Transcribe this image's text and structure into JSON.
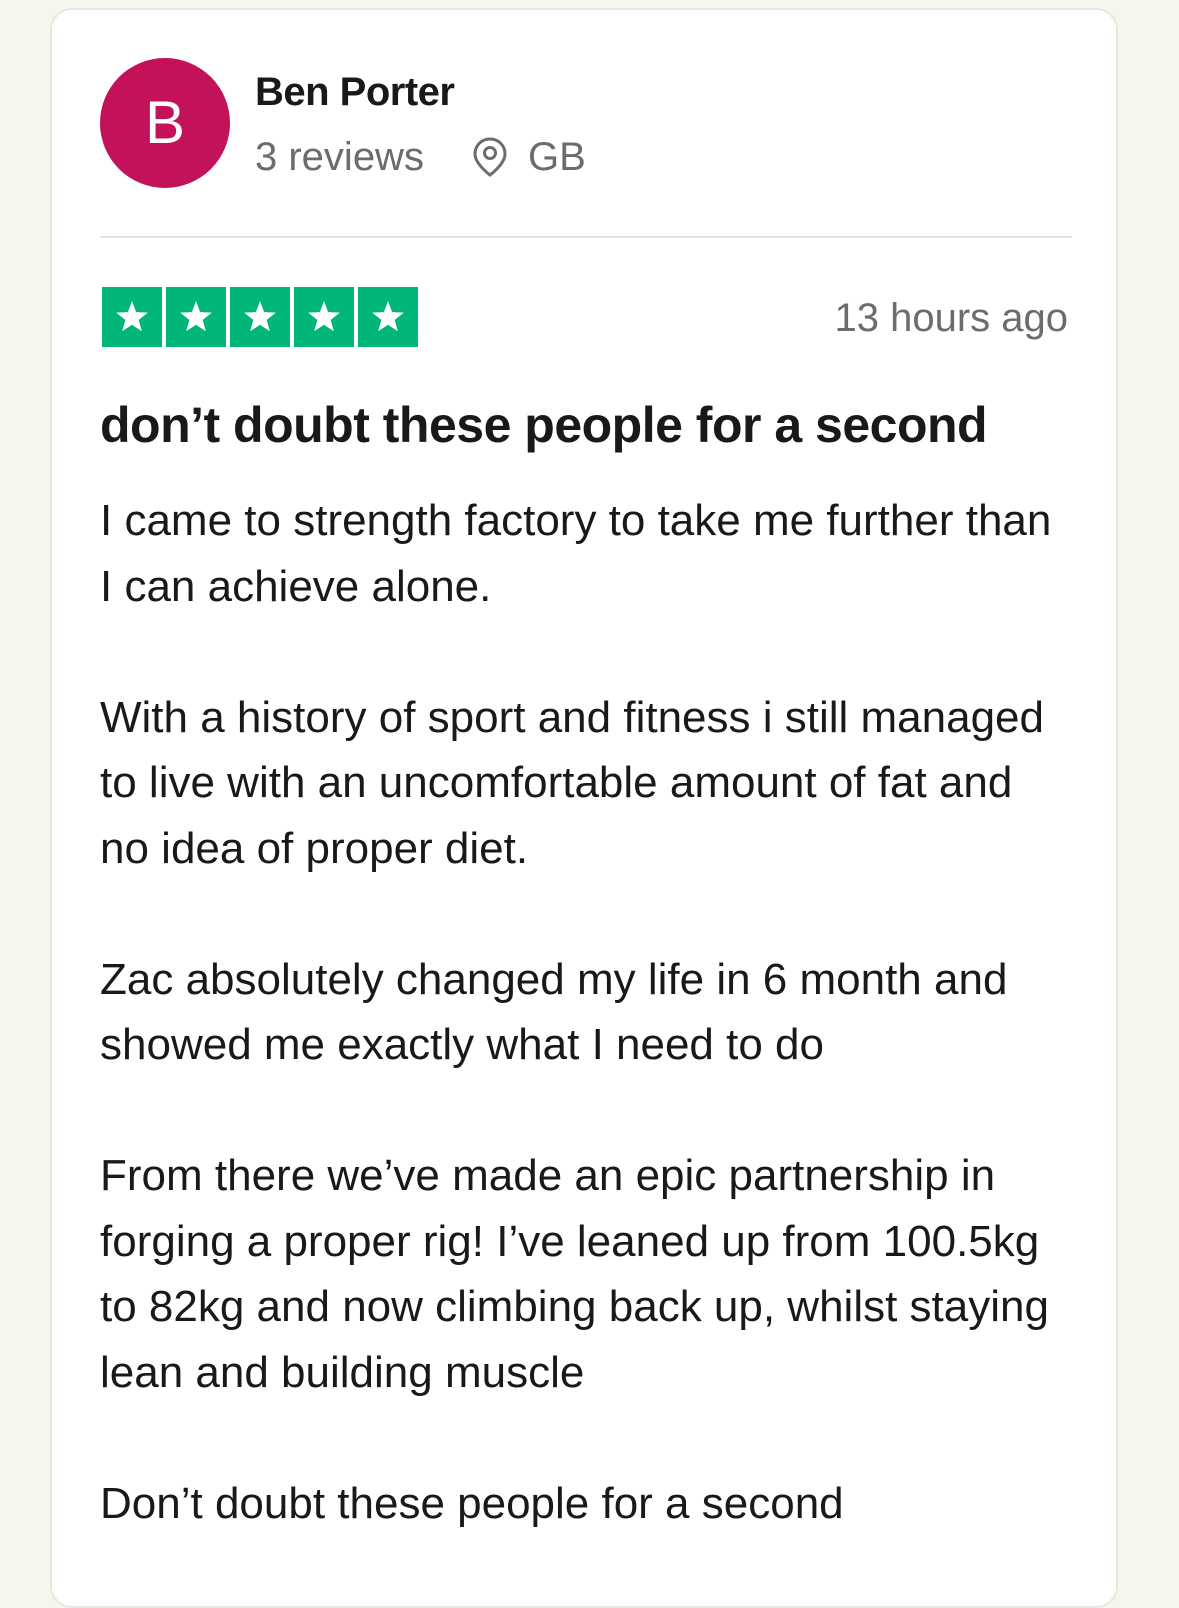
{
  "reviewer": {
    "initial": "B",
    "name": "Ben Porter",
    "reviews_count": "3 reviews",
    "location": "GB",
    "avatar_color": "#c4125a"
  },
  "review": {
    "rating": 5,
    "rating_color": "#00b67a",
    "time": "13 hours ago",
    "title": "don’t doubt these people for a second",
    "paragraphs": [
      "I came to strength factory to take me further than I can achieve alone.",
      "With a history of sport and fitness i still managed to live with an uncomfortable amount of fat and no idea of proper diet.",
      "Zac absolutely changed my life in 6 month and showed me exactly what I need to do",
      "From there we’ve made an epic partnership in forging a proper rig! I’ve leaned up from 100.5kg to 82kg and now climbing back up, whilst staying lean and building muscle",
      "Don’t doubt these people for a second"
    ]
  }
}
